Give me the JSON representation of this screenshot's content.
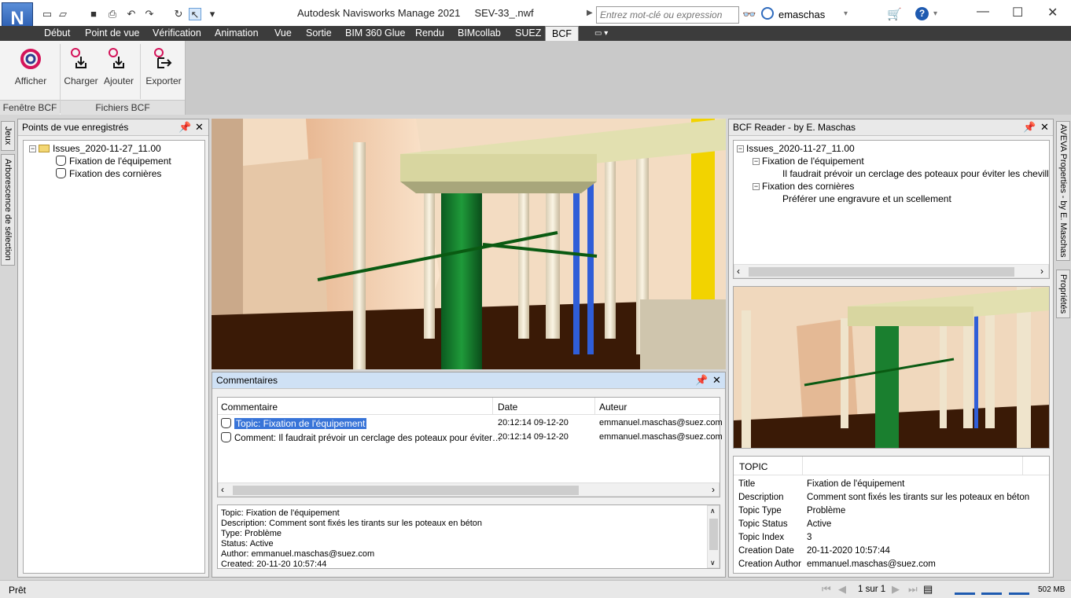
{
  "window": {
    "title": "Autodesk Navisworks Manage 2021",
    "filename": "SEV-33_.nwf",
    "search_placeholder": "Entrez mot-clé ou expression",
    "user": "emaschas",
    "app_letter": "N"
  },
  "ribbon_tabs": [
    "Début",
    "Point de vue",
    "Vérification",
    "Animation",
    "Vue",
    "Sortie",
    "BIM 360 Glue",
    "Rendu",
    "BIMcollab",
    "SUEZ",
    "BCF"
  ],
  "active_tab": "BCF",
  "ribbon": {
    "afficher": "Afficher",
    "charger": "Charger",
    "ajouter": "Ajouter",
    "exporter": "Exporter",
    "group_fenetre": "Fenêtre BCF",
    "group_fichiers": "Fichiers BCF"
  },
  "left_sidetabs": [
    "Jeux",
    "Arborescence de sélection"
  ],
  "right_sidetabs": [
    "AVEVA Properties - by E. Maschas",
    "Propriétés"
  ],
  "viewpoints": {
    "title": "Points de vue enregistrés",
    "folder": "Issues_2020-11-27_11.00",
    "items": [
      "Fixation de l'équipement",
      "Fixation des cornières"
    ]
  },
  "comments": {
    "title": "Commentaires",
    "columns": [
      "Commentaire",
      "Date",
      "Auteur"
    ],
    "rows": [
      {
        "comment": "Topic: Fixation de l'équipement",
        "date": "20:12:14 09-12-20",
        "author": "emmanuel.maschas@suez.com"
      },
      {
        "comment": "Comment: Il faudrait prévoir un cerclage des poteaux pour éviter…",
        "date": "20:12:14 09-12-20",
        "author": "emmanuel.maschas@suez.com"
      }
    ],
    "detail": [
      "Topic: Fixation de l'équipement",
      "Description: Comment sont fixés les tirants sur les poteaux en béton",
      "Type: Problème",
      "Status: Active",
      "Author: emmanuel.maschas@suez.com",
      "Created: 20-11-20 10:57:44"
    ]
  },
  "bcf_reader": {
    "title": "BCF Reader - by E. Maschas",
    "root": "Issues_2020-11-27_11.00",
    "topic1": "Fixation de l'équipement",
    "topic1_comment": "Il faudrait prévoir un cerclage des poteaux pour éviter les chevilles chi",
    "topic2": "Fixation des cornières",
    "topic2_comment": "Préférer une engravure et un scellement",
    "props_header": "TOPIC",
    "props": [
      {
        "k": "Title",
        "v": "Fixation de l'équipement"
      },
      {
        "k": "Description",
        "v": "Comment sont fixés les tirants sur les poteaux en béton"
      },
      {
        "k": "Topic Type",
        "v": "Problème"
      },
      {
        "k": "Topic Status",
        "v": "Active"
      },
      {
        "k": "Topic Index",
        "v": "3"
      },
      {
        "k": "Creation Date",
        "v": "20-11-2020 10:57:44"
      },
      {
        "k": "Creation Author",
        "v": "emmanuel.maschas@suez.com"
      }
    ]
  },
  "status": {
    "ready": "Prêt",
    "page": "1 sur 1",
    "memory": "502 MB"
  }
}
